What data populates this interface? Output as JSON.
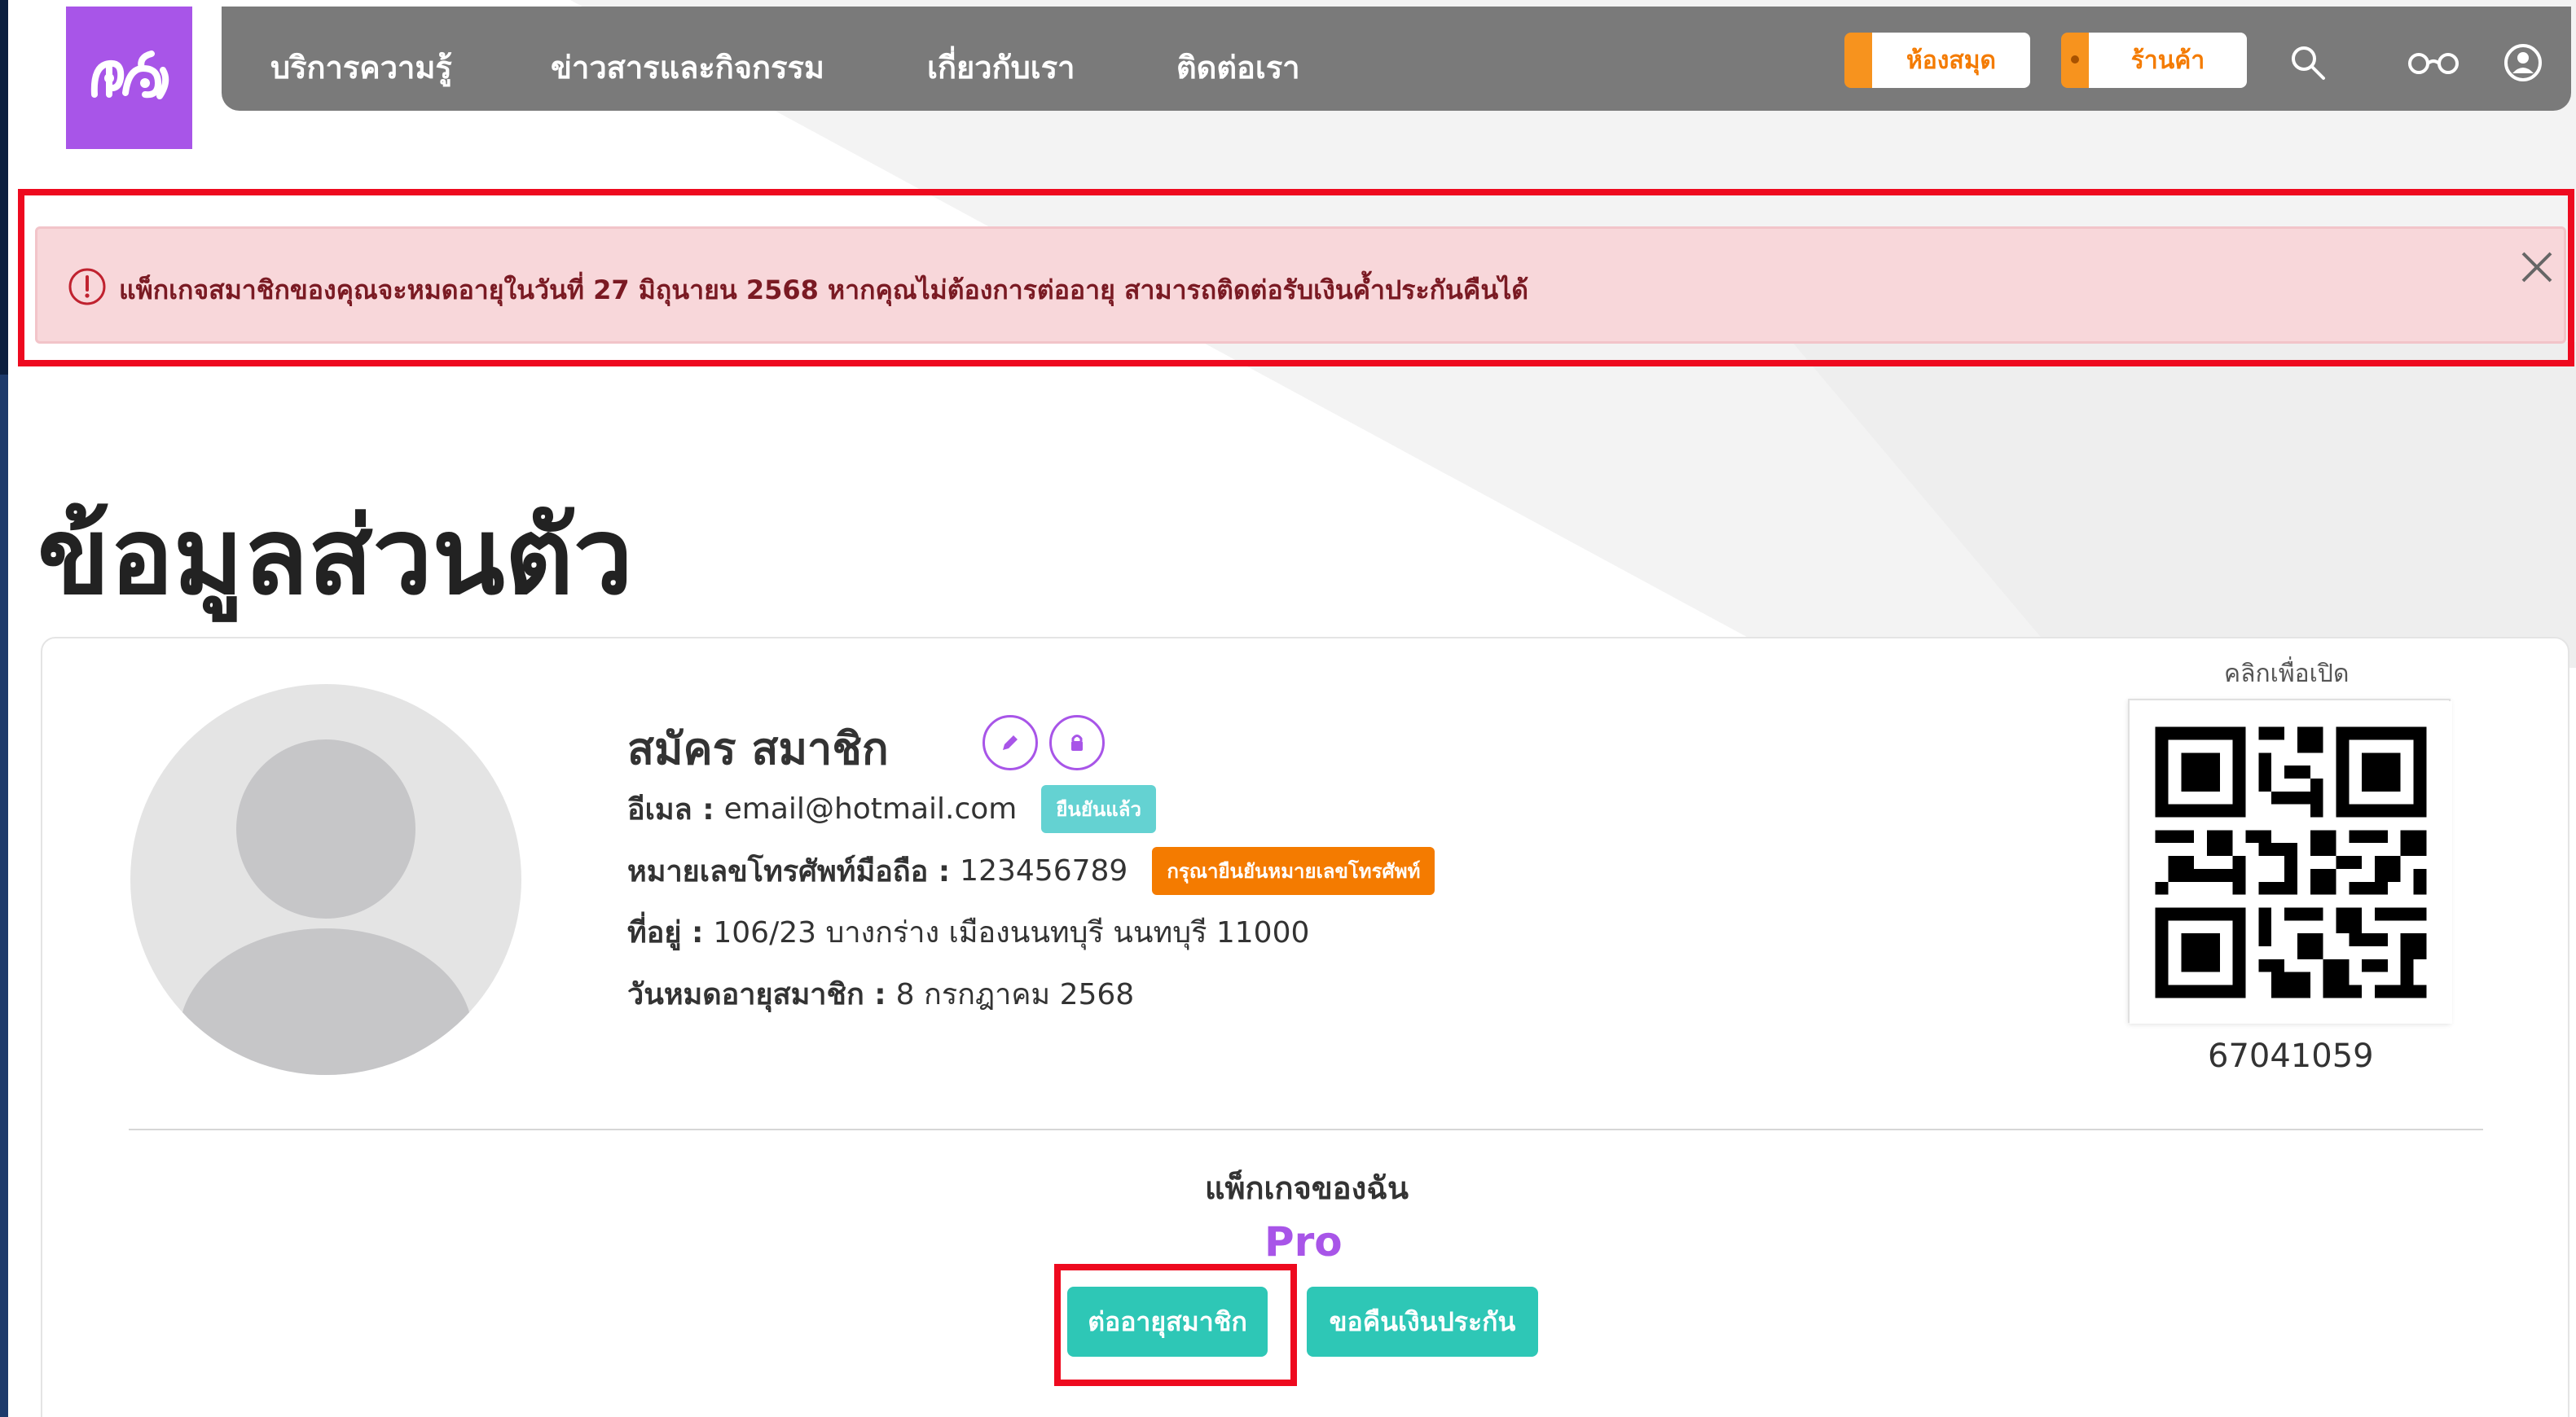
{
  "nav": {
    "logo_alt": "ศุสฺ",
    "links": [
      "บริการความรู้",
      "ข่าวสารและกิจกรรม",
      "เกี่ยวกับเรา",
      "ติดต่อเรา"
    ],
    "library_label": "ห้องสมุด",
    "shop_label": "ร้านค้า",
    "icons": [
      "search-icon",
      "glasses-icon",
      "user-circle-icon"
    ]
  },
  "alert": {
    "message": "แพ็กเกจสมาชิกของคุณจะหมดอายุในวันที่ 27 มิถุนายน 2568 หากคุณไม่ต้องการต่ออายุ สามารถติดต่อรับเงินค้ำประกันคืนได้",
    "icon": "exclamation-circle-icon"
  },
  "page": {
    "title": "ข้อมูลส่วนตัว"
  },
  "profile": {
    "name": "สมัคร สมาชิก",
    "email_label": "อีเมล :",
    "email": "email@hotmail.com",
    "email_status": "ยืนยันแล้ว",
    "phone_label": "หมายเลขโทรศัพท์มือถือ :",
    "phone": "123456789",
    "phone_status": "กรุณายืนยันหมายเลขโทรศัพท์",
    "address_label": "ที่อยู่ :",
    "address": "106/23 บางกร่าง เมืองนนทบุรี นนทบุรี 11000",
    "expiry_label": "วันหมดอายุสมาชิก :",
    "expiry": "8 กรกฎาคม 2568"
  },
  "qr": {
    "caption": "คลิกเพื่อเปิด",
    "member_id": "67041059"
  },
  "package": {
    "label": "แพ็กเกจของฉัน",
    "name": "Pro",
    "renew_label": "ต่ออายุสมาชิก",
    "refund_label": "ขอคืนเงินประกัน"
  },
  "colors": {
    "brand_purple": "#a855e8",
    "nav_gray": "#7a7a7a",
    "orange": "#f47b00",
    "teal": "#2ec7b6",
    "alert_bg": "#f8d7da",
    "highlight_red": "#ee0a1f"
  }
}
